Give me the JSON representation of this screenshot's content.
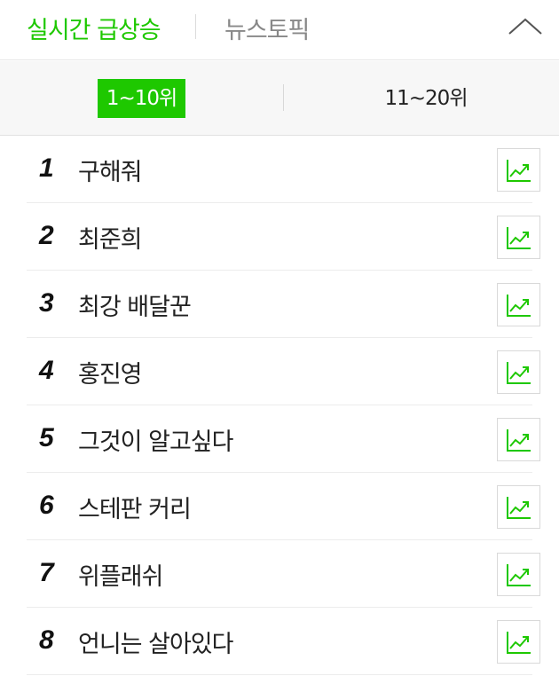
{
  "header": {
    "tab_realtime": "실시간 급상승",
    "tab_news": "뉴스토픽",
    "collapse_icon": "chevron-up-icon"
  },
  "range_tabs": {
    "active": "1~10위",
    "inactive": "11~20위"
  },
  "colors": {
    "accent": "#1ec800",
    "text": "#222222",
    "muted": "#888888"
  },
  "rankings": [
    {
      "rank": "1",
      "keyword": "구해줘"
    },
    {
      "rank": "2",
      "keyword": "최준희"
    },
    {
      "rank": "3",
      "keyword": "최강 배달꾼"
    },
    {
      "rank": "4",
      "keyword": "홍진영"
    },
    {
      "rank": "5",
      "keyword": "그것이 알고싶다"
    },
    {
      "rank": "6",
      "keyword": "스테판 커리"
    },
    {
      "rank": "7",
      "keyword": "위플래쉬"
    },
    {
      "rank": "8",
      "keyword": "언니는 살아있다"
    }
  ],
  "trend_icon": "trend-chart-icon"
}
